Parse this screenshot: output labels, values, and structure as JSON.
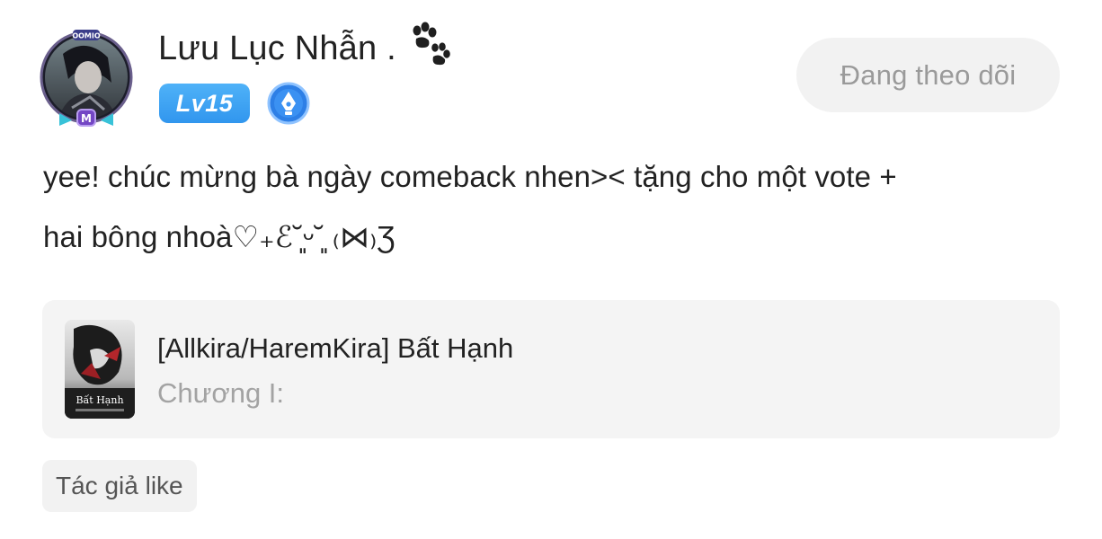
{
  "user": {
    "name": "Lưu Lục Nhẫn .",
    "level": "Lv15",
    "avatar_icon": "user-avatar-framed",
    "emblem_icon": "paw-print-icon",
    "badge_icon": "pen-nib-badge-icon"
  },
  "follow_button": {
    "label": "Đang theo dõi"
  },
  "comment": {
    "lines": [
      "yee! chúc mừng bà ngày comeback nhen>< tặng cho một vote +",
      "hai bông nhoà♡₊ℰ˘͈ᵕ˘͈ ₍⋈₎Ʒ"
    ]
  },
  "linked_story": {
    "title": "[Allkira/HaremKira] Bất Hạnh",
    "chapter": "Chương I:",
    "cover_text": "Bất Hạnh"
  },
  "tags": {
    "author_like": "Tác giả like"
  },
  "colors": {
    "level_badge": "#3ba3f3",
    "follow_button_bg": "#f2f2f2",
    "card_bg": "#f4f4f4"
  }
}
